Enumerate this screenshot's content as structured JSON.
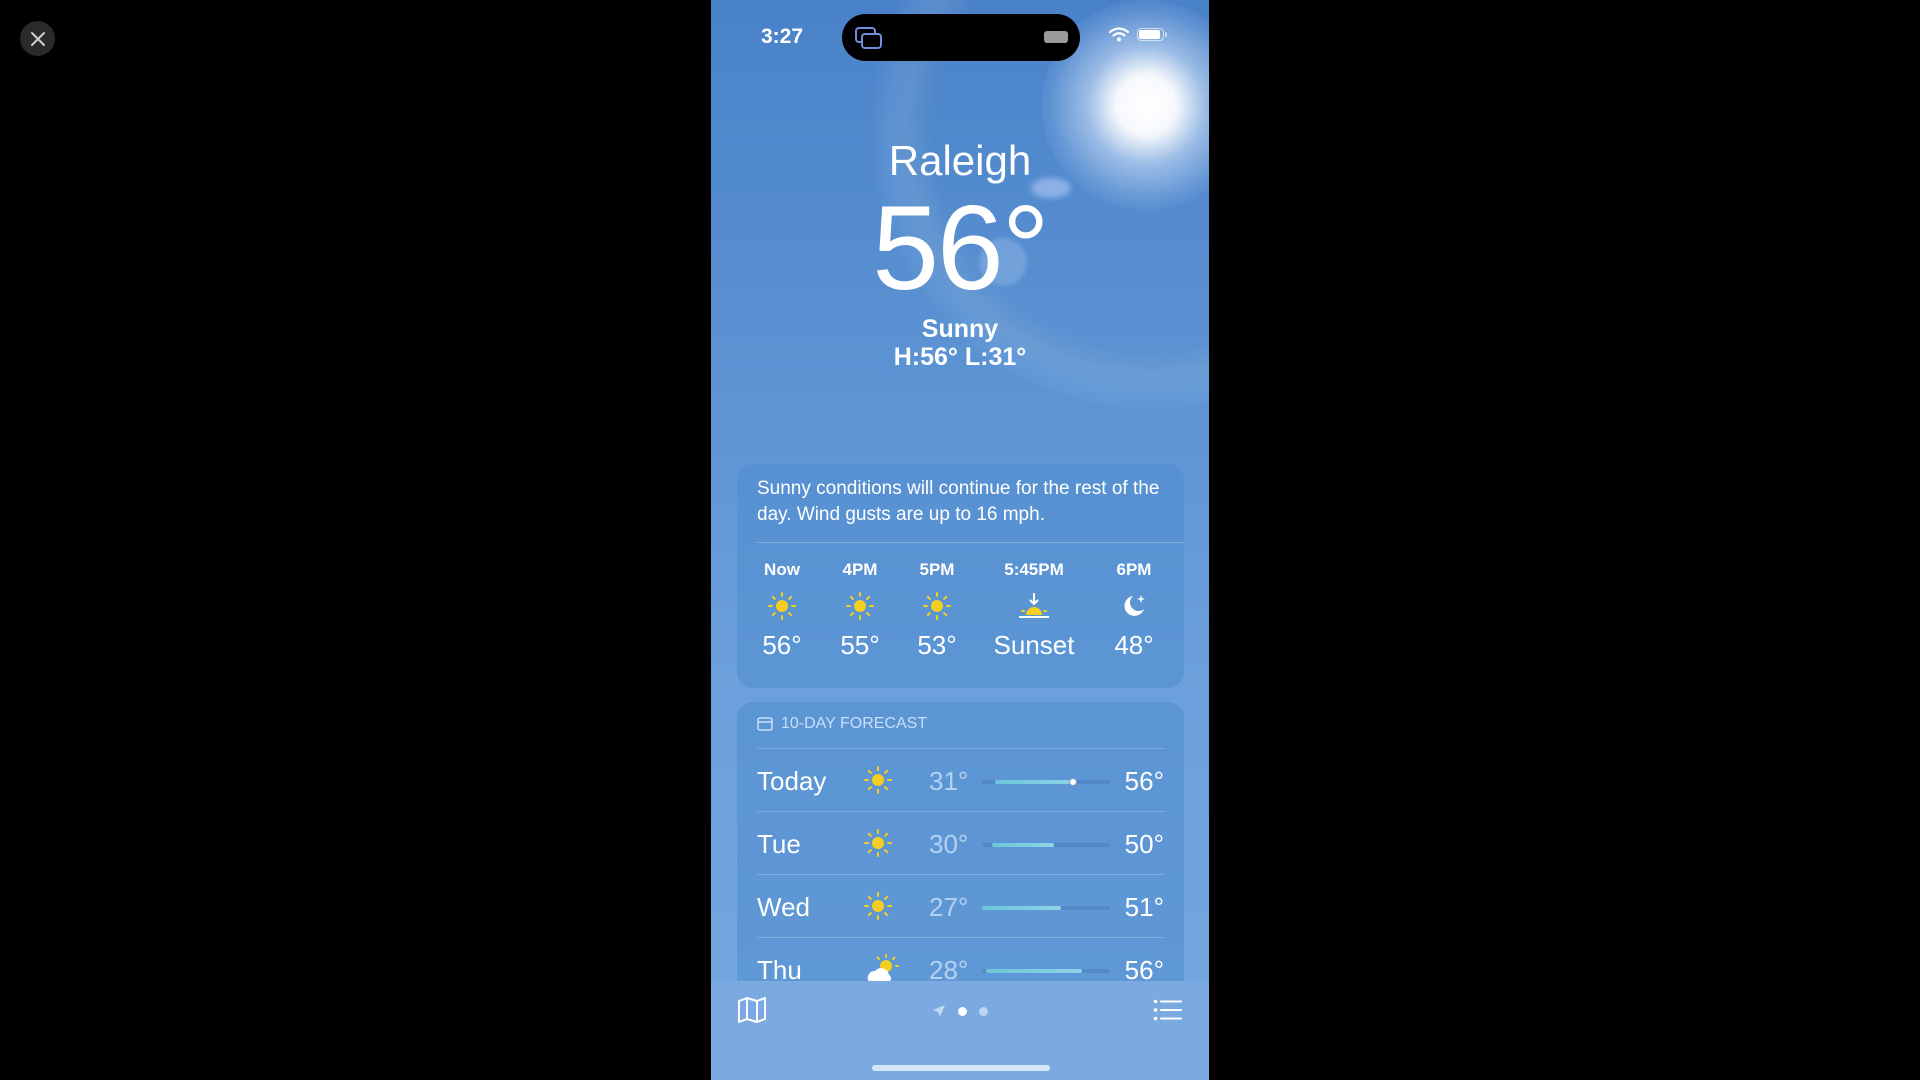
{
  "status": {
    "time": "3:27"
  },
  "weather": {
    "city": "Raleigh",
    "temperature": "56°",
    "condition": "Sunny",
    "high_low": "H:56°  L:31°"
  },
  "hourly": {
    "summary": "Sunny conditions will continue for the rest of the day. Wind gusts are up to 16 mph.",
    "items": [
      {
        "label": "Now",
        "icon": "sun-icon",
        "temp": "56°"
      },
      {
        "label": "4PM",
        "icon": "sun-icon",
        "temp": "55°"
      },
      {
        "label": "5PM",
        "icon": "sun-icon",
        "temp": "53°"
      },
      {
        "label": "5:45PM",
        "icon": "sunset-icon",
        "temp": "Sunset"
      },
      {
        "label": "6PM",
        "icon": "moon-star-icon",
        "temp": "48°"
      }
    ]
  },
  "forecast": {
    "header": "10-DAY FORECAST",
    "days": [
      {
        "day": "Today",
        "icon": "sun-icon",
        "low": "31°",
        "high": "56°",
        "range_start": 0.1,
        "range_end": 0.72,
        "current": 0.7
      },
      {
        "day": "Tue",
        "icon": "sun-icon",
        "low": "30°",
        "high": "50°",
        "range_start": 0.08,
        "range_end": 0.56
      },
      {
        "day": "Wed",
        "icon": "sun-icon",
        "low": "27°",
        "high": "51°",
        "range_start": 0.0,
        "range_end": 0.62
      },
      {
        "day": "Thu",
        "icon": "partly-sunny-icon",
        "low": "28°",
        "high": "56°",
        "range_start": 0.03,
        "range_end": 0.78
      }
    ]
  },
  "colors": {
    "sun_yellow": "#f5cf1f",
    "sky_top": "#4a82c9",
    "sky_bottom": "#75a8e0"
  }
}
